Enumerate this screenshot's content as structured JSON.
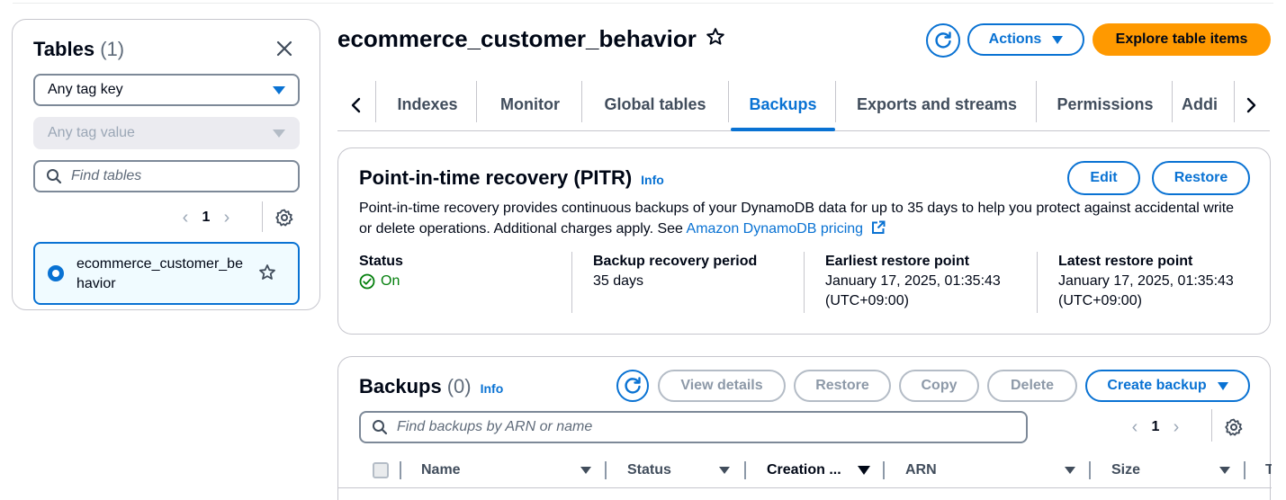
{
  "sidebar": {
    "title": "Tables",
    "count": "(1)",
    "tag_key_select": "Any tag key",
    "tag_value_select": "Any tag value",
    "search_placeholder": "Find tables",
    "page_number": "1",
    "tables": [
      {
        "name": "ecommerce_customer_behavior",
        "selected": true
      }
    ]
  },
  "header": {
    "title": "ecommerce_customer_behavior",
    "actions_label": "Actions",
    "explore_label": "Explore table items"
  },
  "tabs": [
    {
      "label": "Indexes",
      "active": false
    },
    {
      "label": "Monitor",
      "active": false
    },
    {
      "label": "Global tables",
      "active": false
    },
    {
      "label": "Backups",
      "active": true
    },
    {
      "label": "Exports and streams",
      "active": false
    },
    {
      "label": "Permissions",
      "active": false
    },
    {
      "label": "Addi",
      "active": false
    }
  ],
  "pitr": {
    "title": "Point-in-time recovery (PITR)",
    "info": "Info",
    "edit_label": "Edit",
    "restore_label": "Restore",
    "description": "Point-in-time recovery provides continuous backups of your DynamoDB data for up to 35 days to help you protect against accidental write or delete operations. Additional charges apply. See ",
    "pricing_link": "Amazon DynamoDB pricing",
    "status_label": "Status",
    "status_value": "On",
    "period_label": "Backup recovery period",
    "period_value": "35 days",
    "earliest_label": "Earliest restore point",
    "earliest_value_1": "January 17, 2025, 01:35:43",
    "earliest_value_2": "(UTC+09:00)",
    "latest_label": "Latest restore point",
    "latest_value_1": "January 17, 2025, 01:35:43",
    "latest_value_2": "(UTC+09:00)"
  },
  "backups": {
    "title": "Backups",
    "count": "(0)",
    "info": "Info",
    "view_details_label": "View details",
    "restore_label": "Restore",
    "copy_label": "Copy",
    "delete_label": "Delete",
    "create_label": "Create backup",
    "search_placeholder": "Find backups by ARN or name",
    "page_number": "1",
    "columns": [
      "Name",
      "Status",
      "Creation ...",
      "ARN",
      "Size",
      "T"
    ]
  },
  "colors": {
    "accent": "#0972d3",
    "primary_button": "#ff9900",
    "success": "#037f0c"
  }
}
